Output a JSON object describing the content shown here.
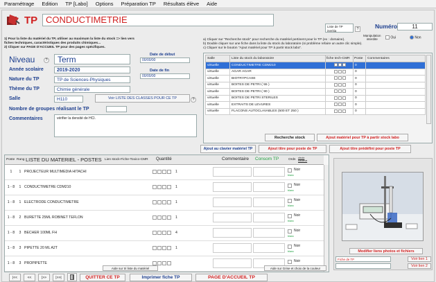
{
  "menu": [
    "Paramétrage",
    "Edition",
    "TP [Labo]",
    "Options",
    "Préparation TP",
    "Résultats élève",
    "Aide"
  ],
  "header": {
    "tp_label": "TP",
    "title": "CONDUCTIMETRIE",
    "liste_tp": "Liste de TP\nineritia",
    "manip_label": "Manipulation\ninterdite",
    "numero_label": "Numéro",
    "numero_value": "11",
    "oui": "Oui",
    "non": "Non",
    "question_mark": "?"
  },
  "instructions_left": [
    "1) Pour la liste du matériel du TP, utiliser au maximum la liste du stock => lien vers",
    "fiches techniques, caractéristiques des produits chimiques...",
    "2) Cliquer sur PAGE D'ACCUEIL TP pour des pages spécifiques."
  ],
  "form": {
    "niveau_label": "Niveau",
    "niveau_value": "Term",
    "annee_label": "Année scolaire",
    "annee_value": "2019-2020",
    "nature_label": "Nature du TP",
    "nature_value": "TP de Sciences-Physiques",
    "theme_label": "Thème du TP",
    "theme_value": "Chimie générale",
    "salle_label": "Salle",
    "salle_value": "H110",
    "voir_btn": "Voir LISTE DES CLASSES POUR CE TP",
    "groupes_label": "Nombre de groupes réalisant le TP",
    "commentaires_label": "Commentaires",
    "commentaires_value": "vérifier la densité de HCl.",
    "date_debut_label": "Date de début",
    "date_debut_value": "00/00/00",
    "date_fin_label": "Date de fin",
    "date_fin_value": "00/00/00",
    "question_mark": "?"
  },
  "stock": {
    "instructions": [
      "a) Cliquer sur \"Recherche stock\" pour recherche du matériel pertinent pour le TP (ex : domaine).",
      "b) Double cliquer sur une fiche dans la liste du stock du laboratoire (si problème refaire un autre clic simple).",
      "c) Cliquer sur le bouton \"Ajout matériel pour TP à partir stock labo\"."
    ],
    "headers": [
      "Salle",
      "Liste du stock du laboratoire",
      "fiche tech-CMR",
      "Poste",
      "Commentaires"
    ],
    "rows": [
      {
        "salle": "virtuelle",
        "nom": "CONDUCTIMETRE CDM210",
        "poste": "0"
      },
      {
        "salle": "virtuelle",
        "nom": "AGAR AGAR",
        "poste": "0"
      },
      {
        "salle": "virtuelle",
        "nom": "BIOTRYPCASE",
        "poste": "0"
      },
      {
        "salle": "virtuelle",
        "nom": "BOITES DE PETRI ( 55 )",
        "poste": "0"
      },
      {
        "salle": "virtuelle",
        "nom": "BOITES DE PETRI ( 90 )",
        "poste": "0"
      },
      {
        "salle": "virtuelle",
        "nom": "BOITES DE PETRI STERILES",
        "poste": "0"
      },
      {
        "salle": "virtuelle",
        "nom": "EXTRAITS DE LEVURES",
        "poste": "0"
      },
      {
        "salle": "virtuelle",
        "nom": "FLACONS AUTOCLAVABLES (500 ET 250 )",
        "poste": "0"
      }
    ],
    "recherche_btn": "Recherche stock",
    "ajout_stock_btn": "Ajout matériel pour TP à partir stock labo"
  },
  "action_buttons": [
    "Ajout au clavier matériel TP",
    "Ajout titre pour poste de TP",
    "Ajout titre prédéfini pour poste TP"
  ],
  "materiel": {
    "headers": {
      "poste": "Poste",
      "rang": "Rang",
      "liste": "LISTE DU MATERIEL - POSTES",
      "lien": "Lien stock-Fiche-Toxico-CMR",
      "quantite": "Quantité",
      "commentaire": "Commentaire",
      "consom": "Consom TP",
      "ords": "Ords",
      "choix": "choix couleur"
    },
    "rows": [
      {
        "poste": "1",
        "rang": "1",
        "nom": "PROJECTEUR MULTIMEDIA HITACHI",
        "qte": "1",
        "couleur": "blanc"
      },
      {
        "poste": "1 - 8",
        "rang": "1",
        "nom": "CONDUCTIMETRE CDM210",
        "qte": "1",
        "couleur": "blanc"
      },
      {
        "poste": "1 - 8",
        "rang": "1",
        "nom": "ELECTRODE CONDUCTIMETRE",
        "qte": "1",
        "couleur": "blanc"
      },
      {
        "poste": "1 - 8",
        "rang": "2",
        "nom": "BURETTE 25ML ROBINET TEFLON",
        "qte": "1",
        "couleur": "blanc"
      },
      {
        "poste": "1 - 8",
        "rang": "3",
        "nom": "BECHER 100ML FH",
        "qte": "4",
        "couleur": "blanc"
      },
      {
        "poste": "1 - 8",
        "rang": "3",
        "nom": "PIPETTE 20 ML A2T",
        "qte": "1",
        "couleur": "blanc"
      },
      {
        "poste": "1 - 8",
        "rang": "3",
        "nom": "PROPIPETTE",
        "qte": "",
        "couleur": "blanc"
      }
    ],
    "noir": "Noir"
  },
  "aide_liste": "Aide sur tri liste du matériel",
  "aide_grise": "Aide sur Grise et choix de la couleur",
  "photo": {
    "modifier_btn": "Modifier liens photos et fichiers",
    "fiche_label": "Fiche de TP",
    "voir1": "Voir lien 1",
    "voir2": "Voir lien 2"
  },
  "bottom": {
    "nav": [
      "|<<",
      "<<",
      "|>>",
      "|>>|"
    ],
    "quitter": "QUITTER CE TP",
    "imprimer": "Imprimer fiche TP",
    "accueil": "PAGE D'ACCUEIL TP"
  },
  "colors": {
    "accent_red": "#d02020",
    "label_blue": "#1d3f8f",
    "selected_row": "#2f6fd6"
  }
}
